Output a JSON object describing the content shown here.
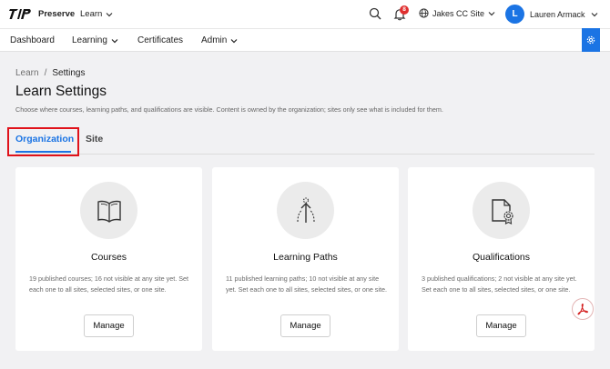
{
  "topbar": {
    "brand": "Preserve",
    "app_switch": "Learn",
    "notifications_count": "8",
    "site_select": "Jakes CC Site",
    "user_initial": "L",
    "user_name": "Lauren Armack"
  },
  "nav": {
    "items": [
      {
        "label": "Dashboard"
      },
      {
        "label": "Learning"
      },
      {
        "label": "Certificates"
      },
      {
        "label": "Admin"
      }
    ]
  },
  "breadcrumb": {
    "parent": "Learn",
    "separator": "/",
    "current": "Settings"
  },
  "page": {
    "title": "Learn Settings",
    "description": "Choose where courses, learning paths, and qualifications are visible. Content is owned by the organization; sites only see what is included for them."
  },
  "tabs": [
    {
      "label": "Organization",
      "active": true
    },
    {
      "label": "Site",
      "active": false
    }
  ],
  "cards": [
    {
      "icon": "book-icon",
      "title": "Courses",
      "description": "19 published courses; 16 not visible at any site yet. Set each one to all sites, selected sites, or one site.",
      "button": "Manage"
    },
    {
      "icon": "path-icon",
      "title": "Learning Paths",
      "description": "11 published learning paths; 10 not visible at any site yet. Set each one to all sites, selected sites, or one site.",
      "button": "Manage"
    },
    {
      "icon": "certificate-icon",
      "title": "Qualifications",
      "description": "3 published qualifications; 2 not visible at any site yet. Set each one to all sites, selected sites, or one site.",
      "button": "Manage"
    }
  ],
  "colors": {
    "accent": "#1b74e4",
    "highlight": "#e0121a",
    "background": "#f1f1f3"
  }
}
